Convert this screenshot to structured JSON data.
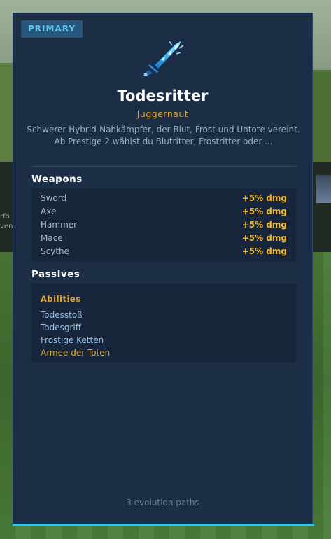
{
  "background": {
    "left_text": [
      "rfo",
      "ven"
    ]
  },
  "card": {
    "badge": "PRIMARY",
    "icon": "ice-sword-icon",
    "title": "Todesritter",
    "subtitle": "Juggernaut",
    "description": "Schwerer Hybrid-Nahkämpfer, der Blut, Frost und Untote vereint. Ab Prestige 2 wählst du Blutritter, Frostritter oder ...",
    "weapons": {
      "heading": "Weapons",
      "items": [
        {
          "name": "Sword",
          "bonus": "+5% dmg"
        },
        {
          "name": "Axe",
          "bonus": "+5% dmg"
        },
        {
          "name": "Hammer",
          "bonus": "+5% dmg"
        },
        {
          "name": "Mace",
          "bonus": "+5% dmg"
        },
        {
          "name": "Scythe",
          "bonus": "+5% dmg"
        }
      ]
    },
    "passives": {
      "heading": "Passives",
      "abilities_heading": "Abilities",
      "abilities": [
        {
          "name": "Todesstoß"
        },
        {
          "name": "Todesgriff"
        },
        {
          "name": "Frostige Ketten"
        },
        {
          "name": "Armee der Toten",
          "ultimate": true
        }
      ]
    },
    "footer": "3 evolution paths"
  },
  "colors": {
    "card_bg": "#1c2e45",
    "accent_cyan": "#3cc4e6",
    "gold": "#e2a52b",
    "bonus_gold": "#f0b627",
    "ability_blue": "#8fc4ef"
  }
}
